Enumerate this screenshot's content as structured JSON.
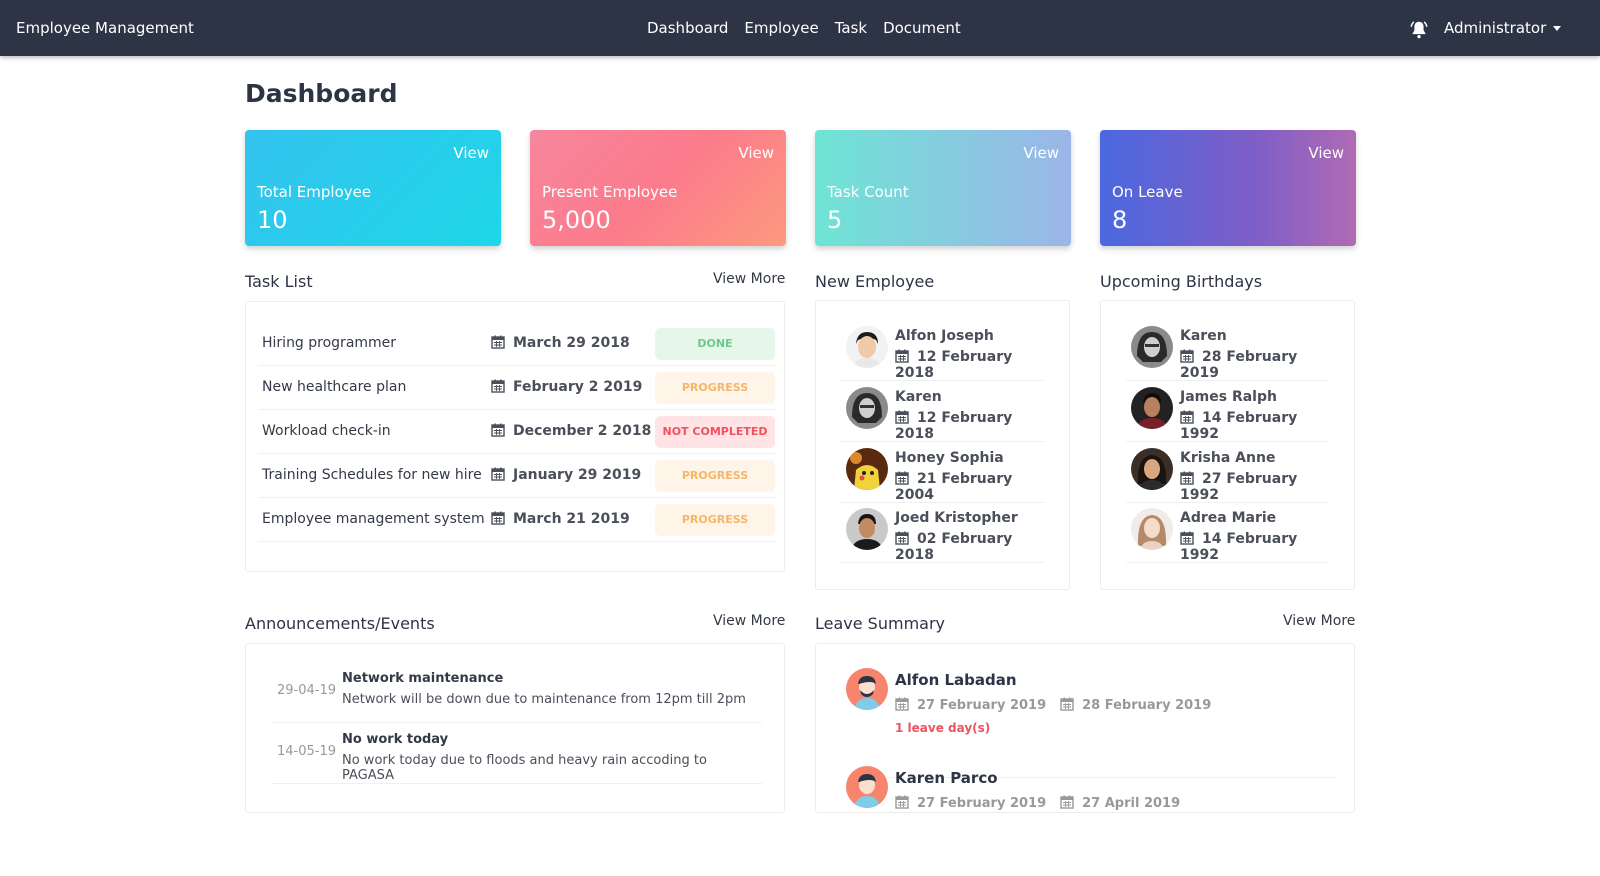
{
  "app": {
    "title": "Employee Management"
  },
  "nav": {
    "links": [
      "Dashboard",
      "Employee",
      "Task",
      "Document"
    ],
    "user": "Administrator"
  },
  "page": {
    "title": "Dashboard"
  },
  "stats": [
    {
      "label": "Total Employee",
      "value": "10",
      "action": "View"
    },
    {
      "label": "Present Employee",
      "value": "5,000",
      "action": "View"
    },
    {
      "label": "Task Count",
      "value": "5",
      "action": "View"
    },
    {
      "label": "On Leave",
      "value": "8",
      "action": "View"
    }
  ],
  "tasks": {
    "title": "Task List",
    "more": "View More",
    "items": [
      {
        "name": "Hiring programmer",
        "date": "March 29 2018",
        "status": "DONE"
      },
      {
        "name": "New healthcare plan",
        "date": "February 2 2019",
        "status": "PROGRESS"
      },
      {
        "name": "Workload check-in",
        "date": "December 2 2018",
        "status": "NOT COMPLETED"
      },
      {
        "name": "Training Schedules for new hire",
        "date": "January 29 2019",
        "status": "PROGRESS"
      },
      {
        "name": "Employee management system",
        "date": "March 21 2019",
        "status": "PROGRESS"
      }
    ]
  },
  "new_employees": {
    "title": "New Employee",
    "items": [
      {
        "name": "Alfon Joseph",
        "date": "12 February 2018"
      },
      {
        "name": "Karen",
        "date": "12 February 2018"
      },
      {
        "name": "Honey Sophia",
        "date": "21 February 2004"
      },
      {
        "name": "Joed Kristopher",
        "date": "02 February 2018"
      }
    ]
  },
  "birthdays": {
    "title": "Upcoming Birthdays",
    "items": [
      {
        "name": "Karen",
        "date": "28 February 2019"
      },
      {
        "name": "James Ralph",
        "date": "14 February 1992"
      },
      {
        "name": "Krisha Anne",
        "date": "27 February 1992"
      },
      {
        "name": "Adrea Marie",
        "date": "14 February 1992"
      }
    ]
  },
  "announcements": {
    "title": "Announcements/Events",
    "more": "View More",
    "items": [
      {
        "date": "29-04-19",
        "title": "Network maintenance",
        "text": "Network will be down due to maintenance from 12pm till 2pm"
      },
      {
        "date": "14-05-19",
        "title": "No work today",
        "text": "No work today due to floods and heavy rain accoding to PAGASA"
      }
    ]
  },
  "leave": {
    "title": "Leave Summary",
    "more": "View More",
    "items": [
      {
        "name": "Alfon Labadan",
        "from": "27 February 2019",
        "to": "28 February 2019",
        "days": "1 leave day(s)"
      },
      {
        "name": "Karen Parco",
        "from": "27 February 2019",
        "to": "27 April 2019",
        "days": ""
      }
    ]
  },
  "colors": {
    "navbar": "#2d3446",
    "done": "#6cc98a",
    "progress": "#f7b56b",
    "not_completed": "#f0525f"
  }
}
